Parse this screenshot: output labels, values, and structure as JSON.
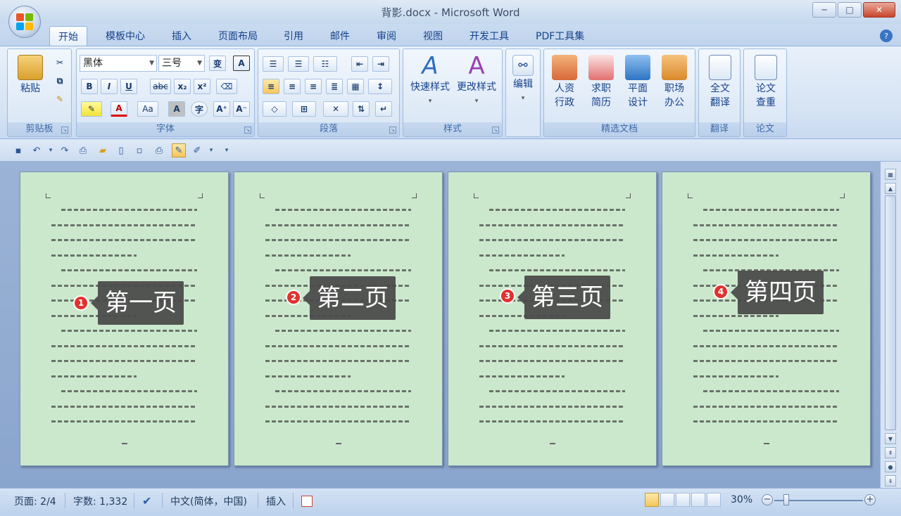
{
  "window": {
    "title": "背影.docx - Microsoft Word",
    "buttons": [
      "─",
      "□",
      "✕"
    ]
  },
  "tabs": [
    "开始",
    "模板中心",
    "插入",
    "页面布局",
    "引用",
    "邮件",
    "审阅",
    "视图",
    "开发工具",
    "PDF工具集"
  ],
  "ribbon": {
    "clipboard": {
      "paste": "粘贴",
      "label": "剪贴板"
    },
    "font": {
      "name": "黑体",
      "size": "三号",
      "label": "字体",
      "buttons": [
        "B",
        "I",
        "U",
        "abc",
        "x₂",
        "x²",
        "A",
        "Aa",
        "A",
        "字",
        "A⁺",
        "A⁻",
        "变",
        "A"
      ]
    },
    "paragraph": {
      "label": "段落"
    },
    "styles": {
      "quick": "快速样式",
      "change": "更改样式",
      "label": "样式"
    },
    "edit": {
      "label": "编辑"
    },
    "templates": {
      "items": [
        "人资行政",
        "求职简历",
        "平面设计",
        "职场办公"
      ],
      "label": "精选文档"
    },
    "translate": {
      "item": "全文翻译",
      "label": "翻译"
    },
    "paper": {
      "item": "论文查重",
      "label": "论文"
    }
  },
  "pages": [
    {
      "badge": "1",
      "callout": "第一页"
    },
    {
      "badge": "2",
      "callout": "第二页"
    },
    {
      "badge": "3",
      "callout": "第三页"
    },
    {
      "badge": "4",
      "callout": "第四页"
    }
  ],
  "status": {
    "page": "页面: 2/4",
    "words": "字数: 1,332",
    "lang": "中文(简体，中国)",
    "mode": "插入",
    "zoom": "30%"
  },
  "colors": {
    "accent": "#15428b",
    "page_bg": "#cbe8cc",
    "badge": "#e0322e"
  }
}
